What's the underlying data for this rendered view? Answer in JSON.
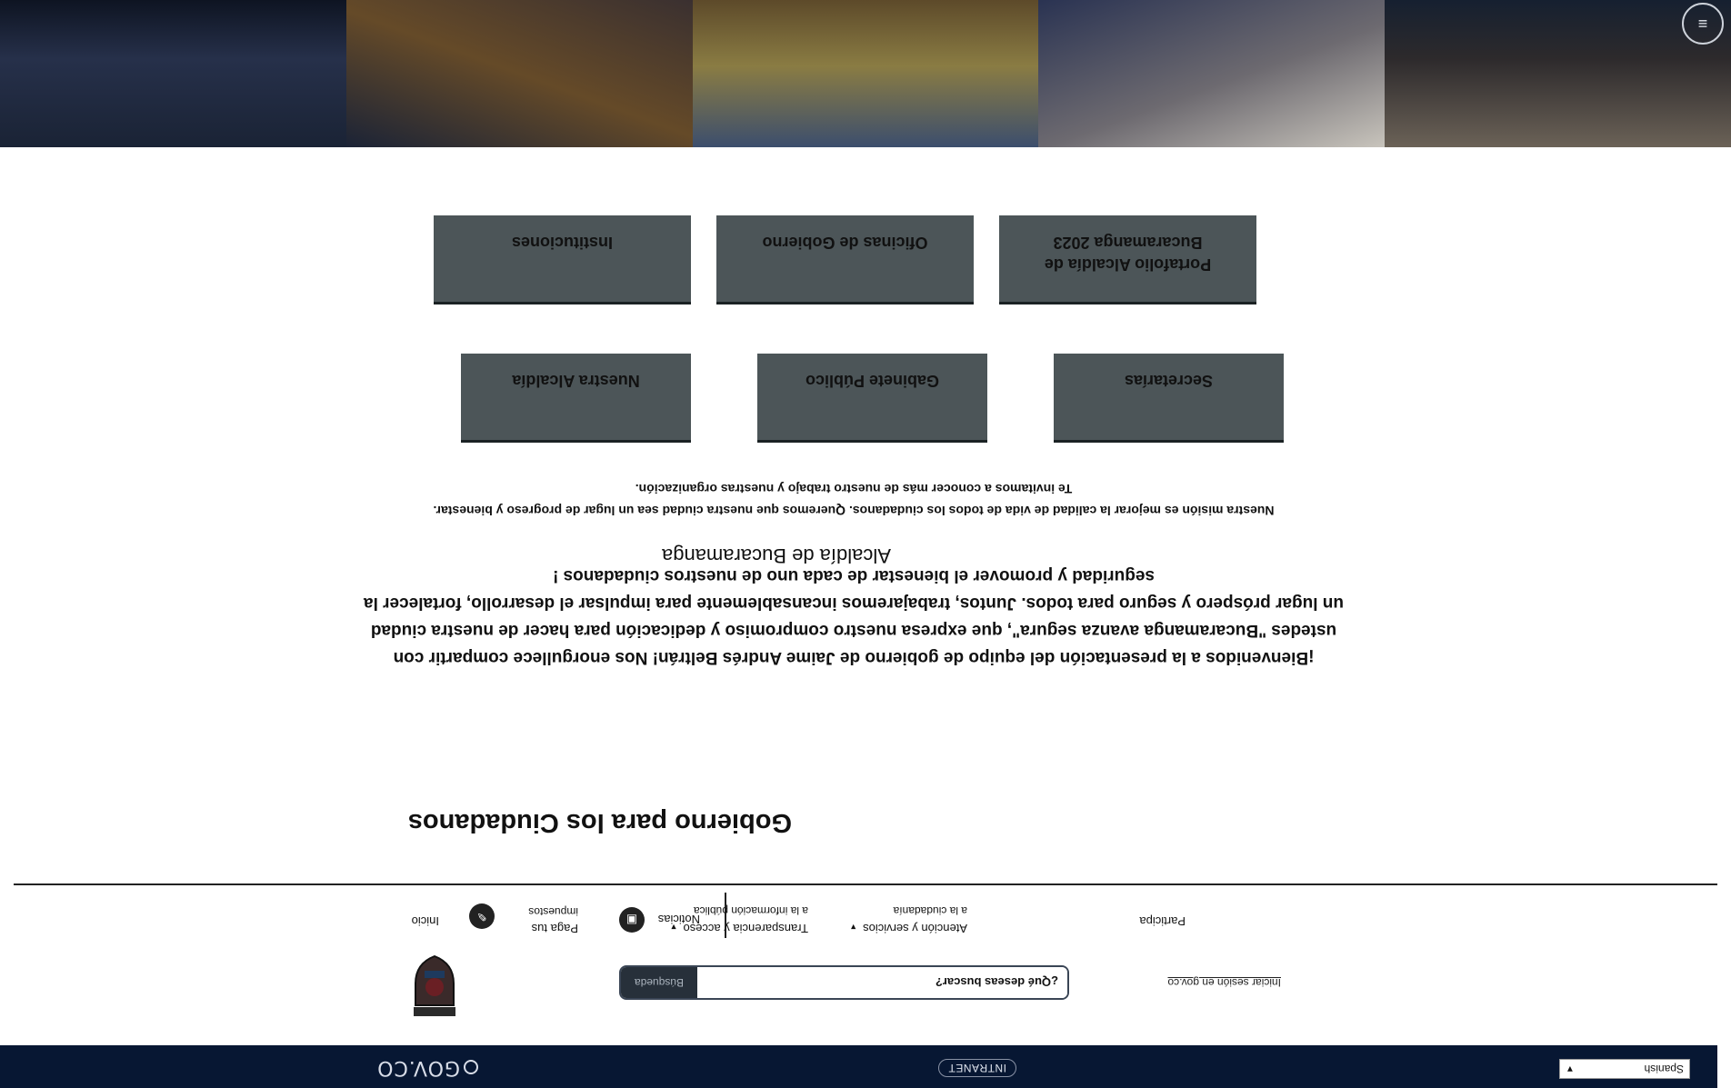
{
  "topbar": {
    "language": "Spanish",
    "intranet_label": "INTRANET",
    "govco_label": "GOV.CO"
  },
  "header": {
    "login_label": "Iniciar sesión en gov.co",
    "search_placeholder": "¿Qué deseas buscar?",
    "search_button": "Búsqueda"
  },
  "nav": {
    "inicio": "Inicio",
    "pagos_line1": "Paga tus",
    "pagos_line2": "impuestos",
    "noticias": "Noticias",
    "transparencia_line1": "Transparencia y acceso",
    "transparencia_line2": "a la información pública",
    "atencion_line1": "Atención y servicios",
    "atencion_line2": "a la ciudadanía",
    "participa": "Participa"
  },
  "main": {
    "title": "Gobierno para los Ciudadanos",
    "intro": "¡Bienvenidos a la presentación del equipo de gobierno de Jaime Andrés Beltrán! Nos enorgullece compartir con ustedes \"Bucaramanga avanza segura\", que expresa nuestro compromiso y dedicación para hacer de nuestra ciudad un lugar próspero y seguro para todos. Juntos, trabajaremos incansablemente para impulsar el desarrollo, fortalecer la seguridad y promover el bienestar de cada uno de nuestros ciudadanos !",
    "org_name": "Alcaldía de Bucaramanga",
    "mission_line1": "Nuestra misión es mejorar la calidad de vida de todos los ciudadanos. Queremos que nuestra ciudad sea un lugar de progreso y bienestar.",
    "mission_line2": "Te invitamos a conocer más de nuestro trabajo y nuestras organización.",
    "cards_row1": [
      "Nuestra Alcaldía",
      "Gabinete Público",
      "Secretarías"
    ],
    "cards_row2": [
      "Instituciones",
      "Oficinas de Gobierno",
      "Portafolio Alcaldía de Bucaramanga 2023"
    ]
  },
  "colors": {
    "topbar_bg": "#071733",
    "card_bg": "#4c5558",
    "search_button_bg": "#27303a"
  },
  "icons": [
    "hamburger-icon",
    "govco-icon",
    "coat-of-arms-logo",
    "pay-icon",
    "news-icon",
    "chevron-down-icon"
  ]
}
